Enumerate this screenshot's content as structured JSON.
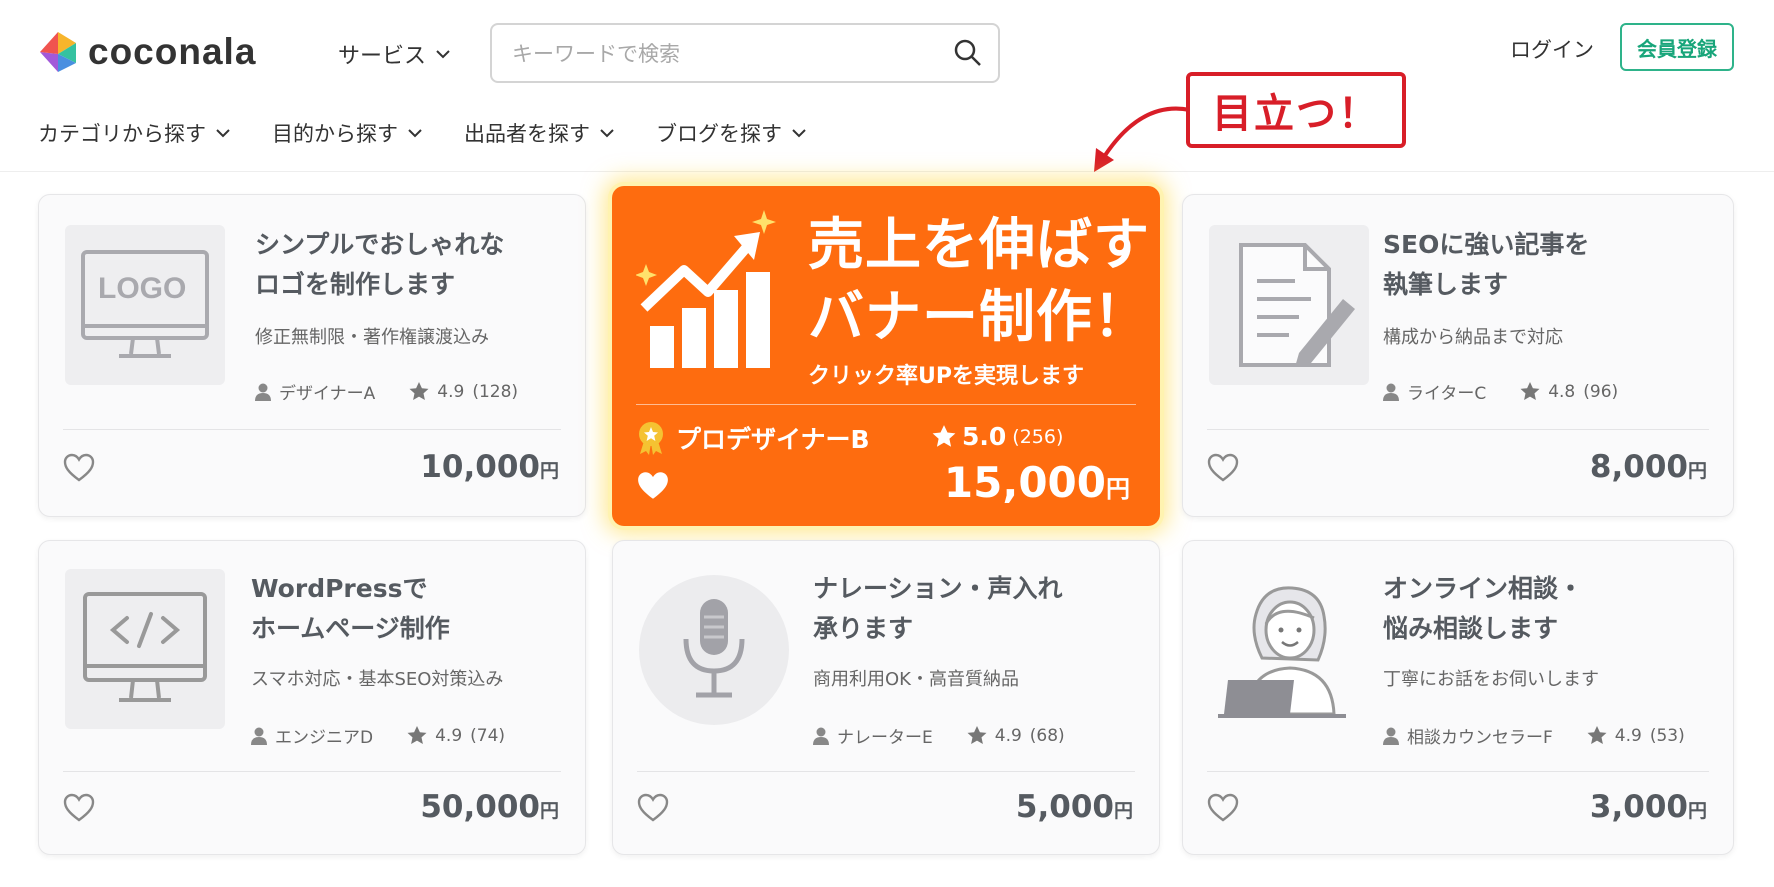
{
  "header": {
    "logo_text": "coconala",
    "service_label": "サービス",
    "search_placeholder": "キーワードで検索",
    "login_label": "ログイン",
    "register_label": "会員登録"
  },
  "nav": [
    "カテゴリから探す",
    "目的から探す",
    "出品者を探す",
    "ブログを探す"
  ],
  "callout": {
    "text": "目立つ！",
    "color": "#d81e28"
  },
  "colors": {
    "accent_orange": "#fe6c0f",
    "register_green": "#18a57a"
  },
  "featured": {
    "title": "売上を伸ばす\nバナー制作！",
    "subtitle": "クリック率UPを実現します",
    "seller": "プロデザイナーB",
    "rating": "5.0",
    "reviews": "(256)",
    "price": "15,000",
    "yen": "円"
  },
  "cards": [
    {
      "title": "シンプルでおしゃれな\nロゴを制作します",
      "subtitle": "修正無制限・著作権譲渡込み",
      "seller": "デザイナーA",
      "rating": "4.9",
      "reviews": "(128)",
      "price": "10,000",
      "yen": "円",
      "thumb_icon": "logo-monitor-icon",
      "thumb_text": "LOGO"
    },
    {
      "title": "SEOに強い記事を\n執筆します",
      "subtitle": "構成から納品まで対応",
      "seller": "ライターC",
      "rating": "4.8",
      "reviews": "(96)",
      "price": "8,000",
      "yen": "円",
      "thumb_icon": "document-pen-icon"
    },
    {
      "title": "WordPressで\nホームページ制作",
      "subtitle": "スマホ対応・基本SEO対策込み",
      "seller": "エンジニアD",
      "rating": "4.9",
      "reviews": "(74)",
      "price": "50,000",
      "yen": "円",
      "thumb_icon": "code-monitor-icon"
    },
    {
      "title": "ナレーション・声入れ\n承ります",
      "subtitle": "商用利用OK・高音質納品",
      "seller": "ナレーターE",
      "rating": "4.9",
      "reviews": "(68)",
      "price": "5,000",
      "yen": "円",
      "thumb_icon": "microphone-icon"
    },
    {
      "title": "オンライン相談・\n悩み相談します",
      "subtitle": "丁寧にお話をお伺いします",
      "seller": "相談カウンセラーF",
      "rating": "4.9",
      "reviews": "(53)",
      "price": "3,000",
      "yen": "円",
      "thumb_icon": "counselor-laptop-icon"
    }
  ]
}
